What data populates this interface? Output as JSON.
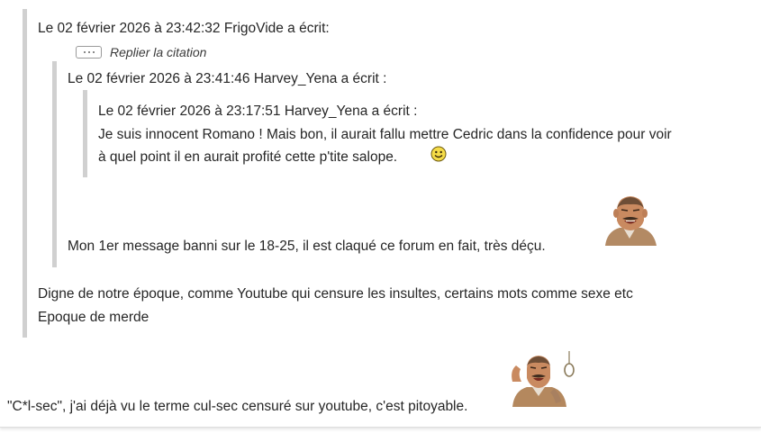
{
  "outer_quote": {
    "header": "Le 02 février 2026 à 23:42:32 FrigoVide a écrit:",
    "toggle_label": "Replier la citation",
    "body_line1": "Digne de notre époque, comme Youtube qui censure les insultes, certains mots comme sexe etc",
    "body_line2": "Epoque de merde"
  },
  "middle_quote": {
    "header": "Le 02 février 2026 à 23:41:46 Harvey_Yena a écrit :",
    "body": "Mon 1er message banni sur le 18-25, il est claqué ce forum en fait, très déçu."
  },
  "inner_quote": {
    "header": "Le 02 février 2026 à 23:17:51 Harvey_Yena a écrit :",
    "body_line1": "Je suis innocent Romano ! Mais bon, il aurait fallu mettre Cedric dans la confidence pour voir",
    "body_line2": "à quel point il en aurait profité cette p'tite salope."
  },
  "reply_text": "\"C*l-sec\", j'ai déjà vu le terme cul-sec censuré sur youtube, c'est pitoyable.",
  "icons": {
    "toggle": "ellipsis-icon",
    "smiley": "smiley-emoji-icon",
    "sticker1": "laughing-man-sticker",
    "sticker2": "man-with-noose-sticker"
  }
}
